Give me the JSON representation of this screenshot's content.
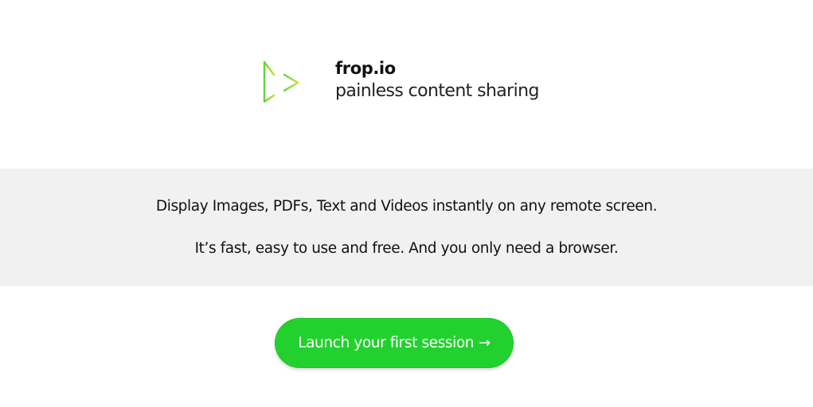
{
  "brand": {
    "name": "frop.io",
    "tagline": "painless content sharing",
    "logo_icon": "play-triangle-icon",
    "logo_colors": [
      "#5fd33a",
      "#c8e22a"
    ]
  },
  "intro": {
    "line1": "Display Images, PDFs, Text and Videos instantly on any remote screen.",
    "line2": "It’s fast, easy to use and free. And you only need a browser."
  },
  "cta": {
    "label": "Launch your first session",
    "arrow": "→",
    "arrow_icon": "arrow-right-icon",
    "color": "#22d12e"
  }
}
